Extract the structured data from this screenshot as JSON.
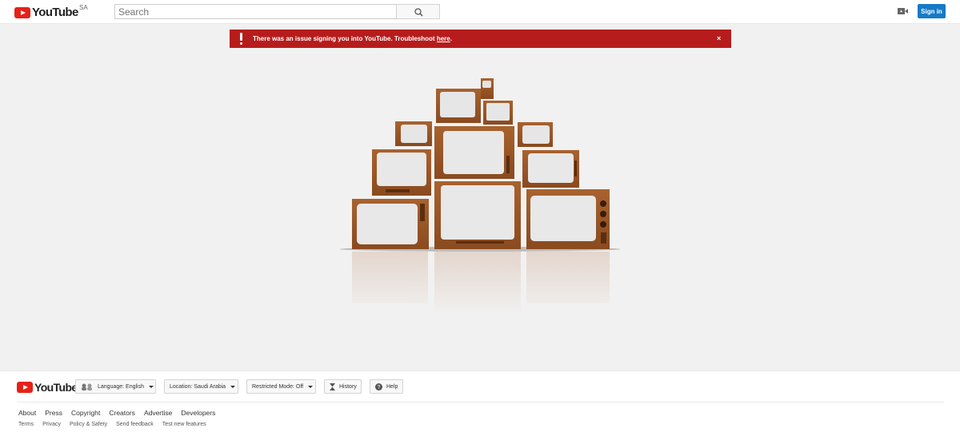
{
  "header": {
    "logo_text": "YouTube",
    "country_code": "SA",
    "search_placeholder": "Search",
    "signin_label": "Sign in"
  },
  "alert": {
    "message": "There was an issue signing you into YouTube. Troubleshoot ",
    "link_text": "here",
    "suffix": ".",
    "close_glyph": "×",
    "color": "#b71c1c"
  },
  "footer": {
    "logo_text": "YouTube",
    "language_label": "Language:",
    "language_value": "English",
    "location_label": "Location:",
    "location_value": "Saudi Arabia",
    "restricted_label": "Restricted Mode:",
    "restricted_value": "Off",
    "history_label": "History",
    "help_label": "Help",
    "primary_links": [
      "About",
      "Press",
      "Copyright",
      "Creators",
      "Advertise",
      "Developers"
    ],
    "secondary_links": [
      "Terms",
      "Privacy",
      "Policy & Safety",
      "Send feedback",
      "Test new features"
    ]
  },
  "colors": {
    "brand_red": "#e62117",
    "signin_blue": "#167ac6",
    "tv_wood": "#9c5a2a"
  }
}
